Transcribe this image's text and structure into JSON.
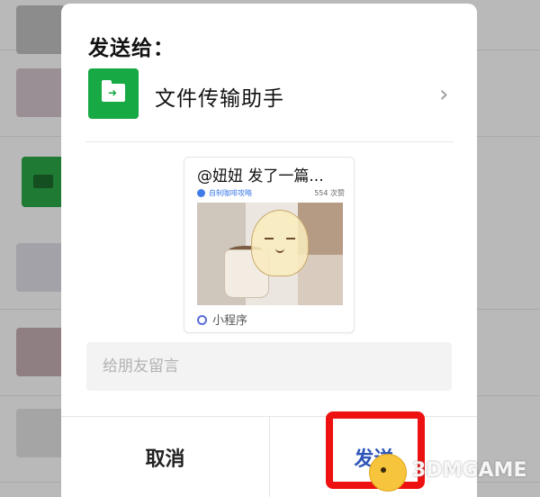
{
  "dialog": {
    "title": "发送给：",
    "recipient": {
      "name": "文件传输助手",
      "icon": "folder-transfer-icon"
    },
    "shared_card": {
      "title": "@妞妞 发了一篇...",
      "tag": "自制咖啡攻略",
      "likes": "554 次赞",
      "footer": "小程序"
    },
    "message_input": {
      "placeholder": "给朋友留言"
    },
    "buttons": {
      "cancel": "取消",
      "send": "发送"
    }
  },
  "watermark": "3DMGAME",
  "colors": {
    "accent_green": "#17a944",
    "send_blue": "#2e55b8",
    "highlight_red": "#ee1111",
    "overlay_gray": "#b9b9b9"
  }
}
